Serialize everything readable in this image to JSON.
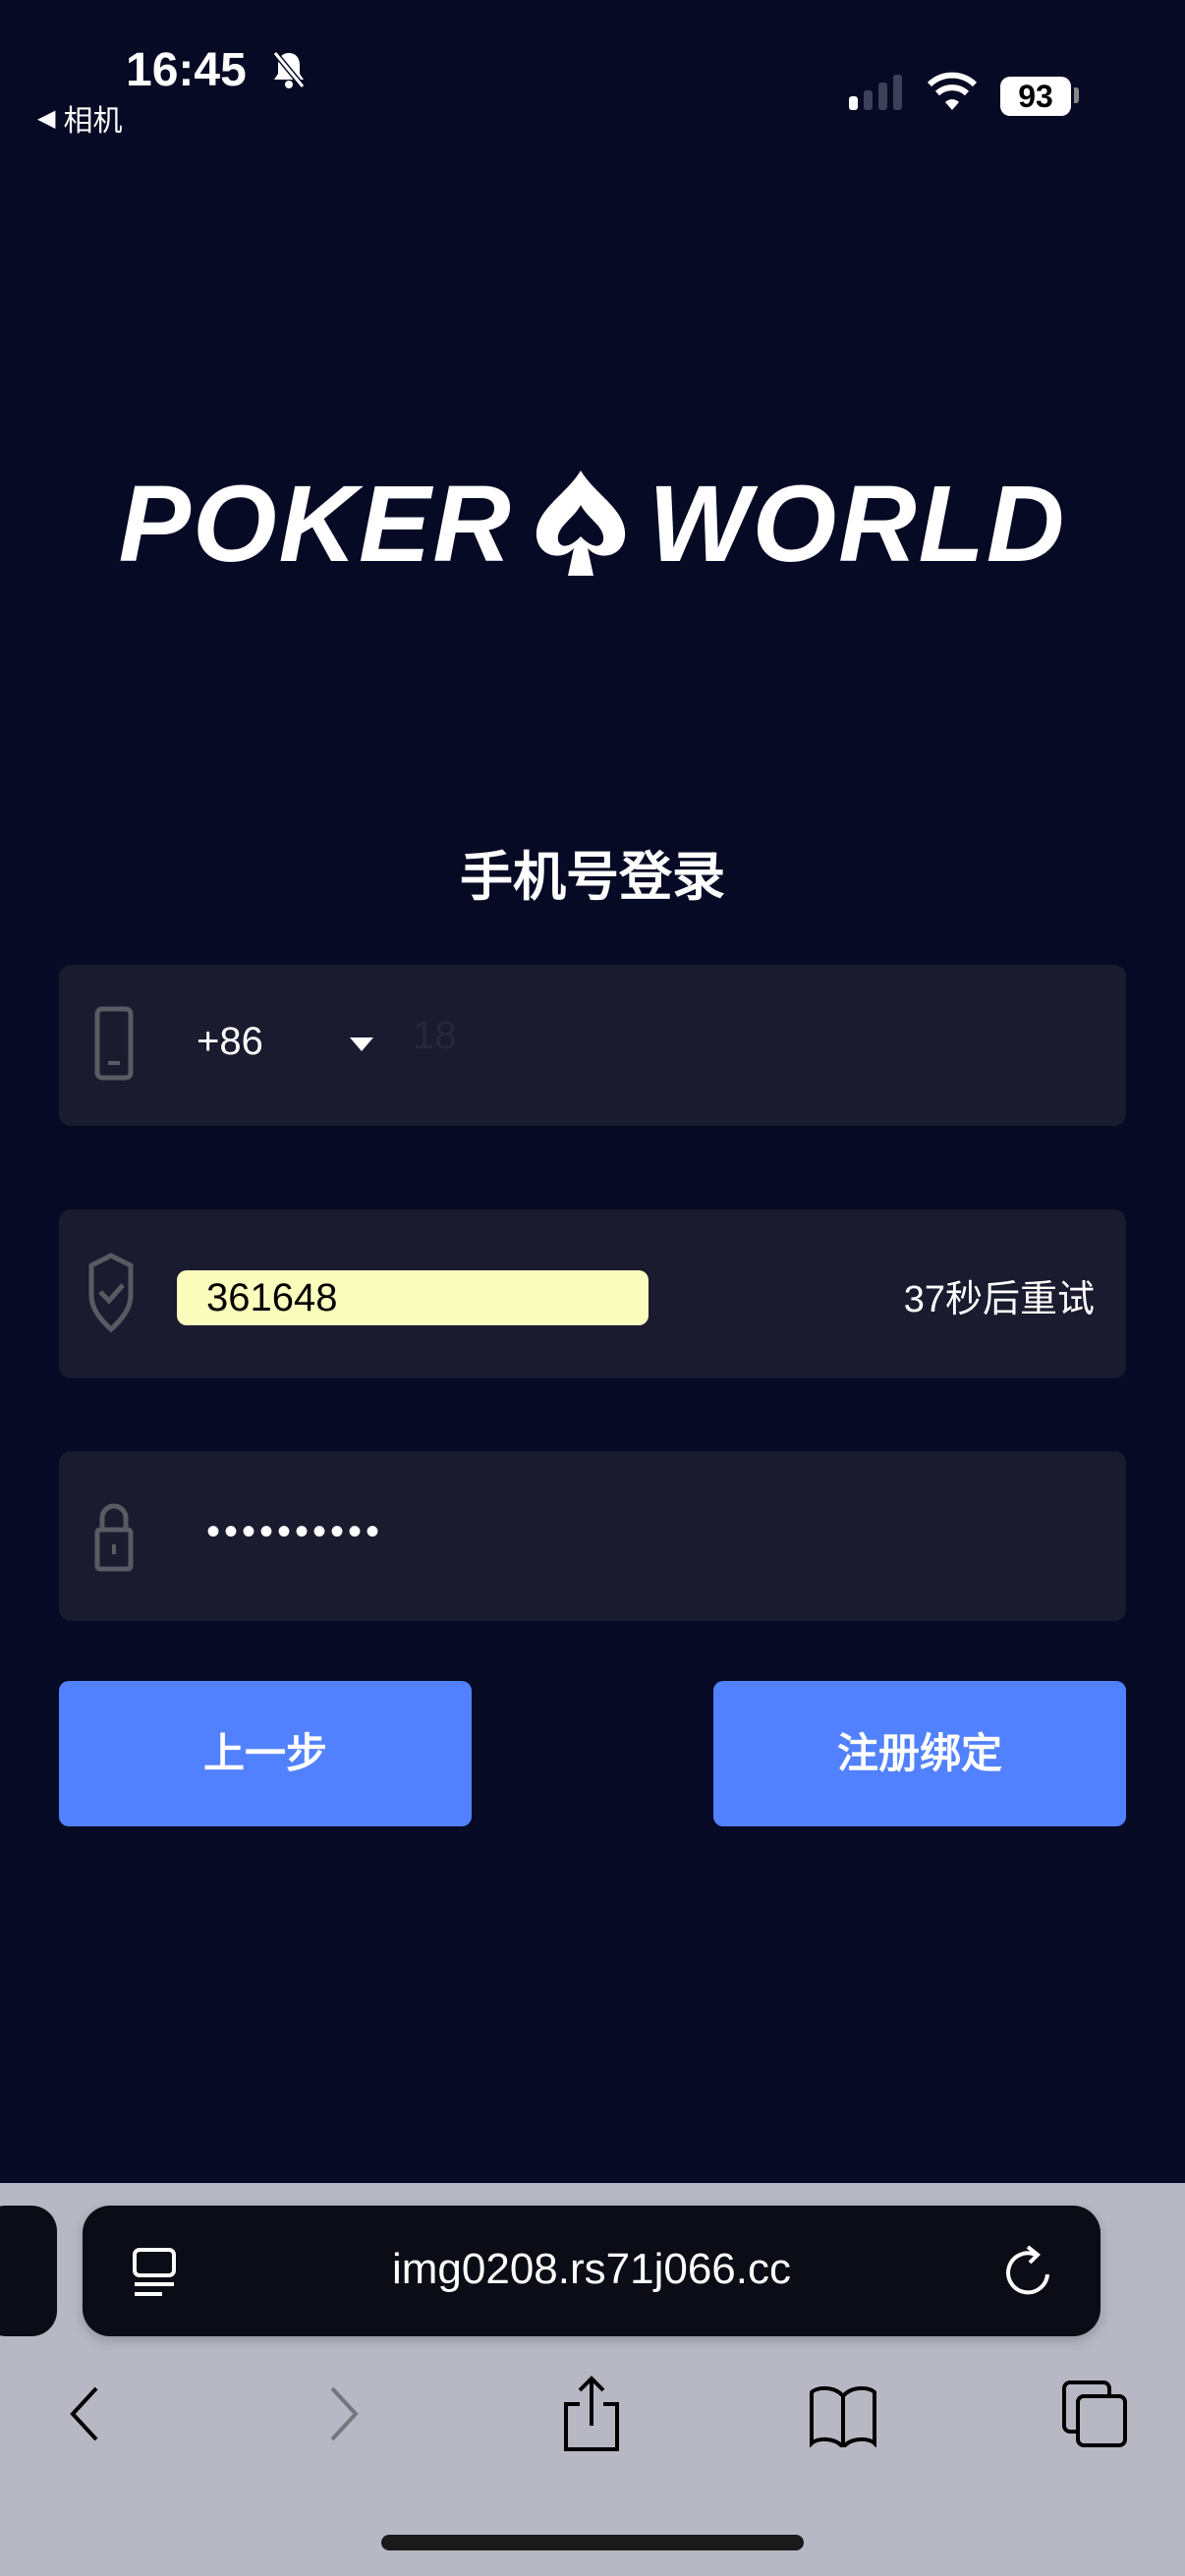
{
  "status_bar": {
    "time": "16:45",
    "back_app": "相机",
    "battery": "93"
  },
  "logo": {
    "left": "POKER",
    "right": "WORLD"
  },
  "title": "手机号登录",
  "phone_field": {
    "country_code": "+86",
    "value_obscured": "18"
  },
  "code_field": {
    "value": "361648",
    "retry_label": "37秒后重试"
  },
  "password_field": {
    "value": "••••••••••"
  },
  "buttons": {
    "back": "上一步",
    "register": "注册绑定"
  },
  "browser": {
    "url": "img0208.rs71j066.cc"
  },
  "colors": {
    "background": "#060a24",
    "field": "#1a1b2e",
    "button": "#5181fe",
    "autofill": "#fafdbc"
  }
}
